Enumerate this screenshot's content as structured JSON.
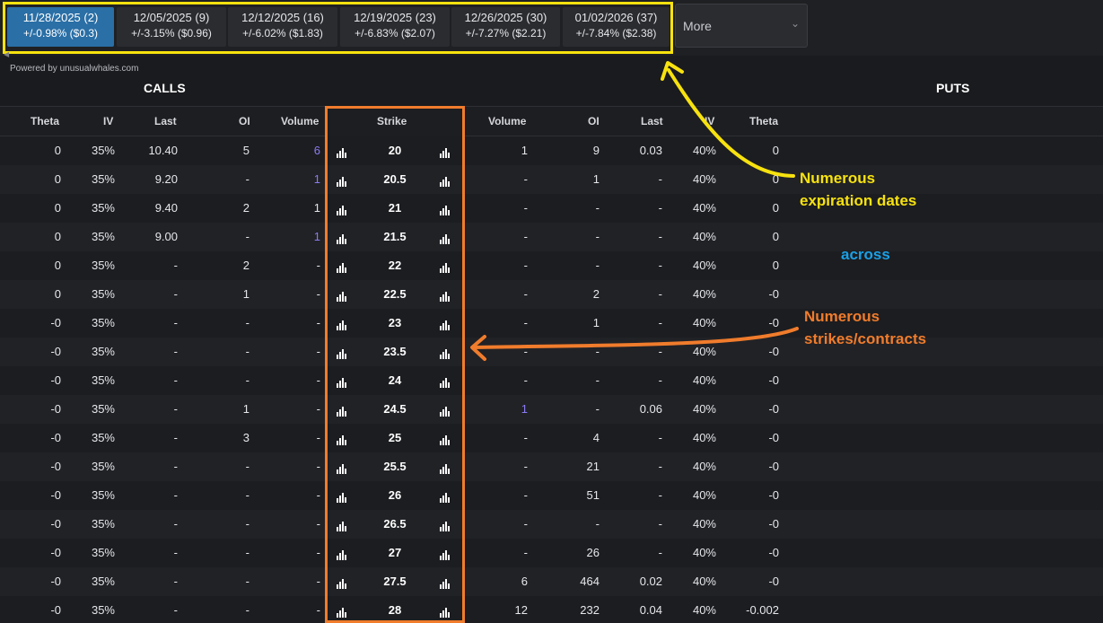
{
  "expirations": [
    {
      "date": "11/28/2025 (2)",
      "move": "+/-0.98% ($0.3)",
      "active": true
    },
    {
      "date": "12/05/2025 (9)",
      "move": "+/-3.15% ($0.96)",
      "active": false
    },
    {
      "date": "12/12/2025 (16)",
      "move": "+/-6.02% ($1.83)",
      "active": false
    },
    {
      "date": "12/19/2025 (23)",
      "move": "+/-6.83% ($2.07)",
      "active": false
    },
    {
      "date": "12/26/2025 (30)",
      "move": "+/-7.27% ($2.21)",
      "active": false
    },
    {
      "date": "01/02/2026 (37)",
      "move": "+/-7.84% ($2.38)",
      "active": false
    }
  ],
  "more_label": "More",
  "more_chevron": "⌄",
  "powered_by": "Powered by unusualwhales.com",
  "calls_title": "CALLS",
  "puts_title": "PUTS",
  "headers": {
    "calls": [
      "Theta",
      "IV",
      "Last",
      "OI",
      "Volume"
    ],
    "strike": "Strike",
    "puts": [
      "Volume",
      "OI",
      "Last",
      "IV",
      "Theta"
    ]
  },
  "rows": [
    {
      "c_theta": "0",
      "c_iv": "35%",
      "c_last": "10.40",
      "c_oi": "5",
      "c_vol": "6",
      "c_vol_hl": true,
      "strike": "20",
      "p_vol": "1",
      "p_vol_hl": false,
      "p_oi": "9",
      "p_last": "0.03",
      "p_iv": "40%",
      "p_theta": "0"
    },
    {
      "c_theta": "0",
      "c_iv": "35%",
      "c_last": "9.20",
      "c_oi": "-",
      "c_vol": "1",
      "c_vol_hl": true,
      "strike": "20.5",
      "p_vol": "-",
      "p_vol_hl": false,
      "p_oi": "1",
      "p_last": "-",
      "p_iv": "40%",
      "p_theta": "0"
    },
    {
      "c_theta": "0",
      "c_iv": "35%",
      "c_last": "9.40",
      "c_oi": "2",
      "c_vol": "1",
      "c_vol_hl": false,
      "strike": "21",
      "p_vol": "-",
      "p_vol_hl": false,
      "p_oi": "-",
      "p_last": "-",
      "p_iv": "40%",
      "p_theta": "0"
    },
    {
      "c_theta": "0",
      "c_iv": "35%",
      "c_last": "9.00",
      "c_oi": "-",
      "c_vol": "1",
      "c_vol_hl": true,
      "strike": "21.5",
      "p_vol": "-",
      "p_vol_hl": false,
      "p_oi": "-",
      "p_last": "-",
      "p_iv": "40%",
      "p_theta": "0"
    },
    {
      "c_theta": "0",
      "c_iv": "35%",
      "c_last": "-",
      "c_oi": "2",
      "c_vol": "-",
      "c_vol_hl": false,
      "strike": "22",
      "p_vol": "-",
      "p_vol_hl": false,
      "p_oi": "-",
      "p_last": "-",
      "p_iv": "40%",
      "p_theta": "0"
    },
    {
      "c_theta": "0",
      "c_iv": "35%",
      "c_last": "-",
      "c_oi": "1",
      "c_vol": "-",
      "c_vol_hl": false,
      "strike": "22.5",
      "p_vol": "-",
      "p_vol_hl": false,
      "p_oi": "2",
      "p_last": "-",
      "p_iv": "40%",
      "p_theta": "-0"
    },
    {
      "c_theta": "-0",
      "c_iv": "35%",
      "c_last": "-",
      "c_oi": "-",
      "c_vol": "-",
      "c_vol_hl": false,
      "strike": "23",
      "p_vol": "-",
      "p_vol_hl": false,
      "p_oi": "1",
      "p_last": "-",
      "p_iv": "40%",
      "p_theta": "-0"
    },
    {
      "c_theta": "-0",
      "c_iv": "35%",
      "c_last": "-",
      "c_oi": "-",
      "c_vol": "-",
      "c_vol_hl": false,
      "strike": "23.5",
      "p_vol": "-",
      "p_vol_hl": false,
      "p_oi": "-",
      "p_last": "-",
      "p_iv": "40%",
      "p_theta": "-0"
    },
    {
      "c_theta": "-0",
      "c_iv": "35%",
      "c_last": "-",
      "c_oi": "-",
      "c_vol": "-",
      "c_vol_hl": false,
      "strike": "24",
      "p_vol": "-",
      "p_vol_hl": false,
      "p_oi": "-",
      "p_last": "-",
      "p_iv": "40%",
      "p_theta": "-0"
    },
    {
      "c_theta": "-0",
      "c_iv": "35%",
      "c_last": "-",
      "c_oi": "1",
      "c_vol": "-",
      "c_vol_hl": false,
      "strike": "24.5",
      "p_vol": "1",
      "p_vol_hl": true,
      "p_oi": "-",
      "p_last": "0.06",
      "p_iv": "40%",
      "p_theta": "-0"
    },
    {
      "c_theta": "-0",
      "c_iv": "35%",
      "c_last": "-",
      "c_oi": "3",
      "c_vol": "-",
      "c_vol_hl": false,
      "strike": "25",
      "p_vol": "-",
      "p_vol_hl": false,
      "p_oi": "4",
      "p_last": "-",
      "p_iv": "40%",
      "p_theta": "-0"
    },
    {
      "c_theta": "-0",
      "c_iv": "35%",
      "c_last": "-",
      "c_oi": "-",
      "c_vol": "-",
      "c_vol_hl": false,
      "strike": "25.5",
      "p_vol": "-",
      "p_vol_hl": false,
      "p_oi": "21",
      "p_last": "-",
      "p_iv": "40%",
      "p_theta": "-0"
    },
    {
      "c_theta": "-0",
      "c_iv": "35%",
      "c_last": "-",
      "c_oi": "-",
      "c_vol": "-",
      "c_vol_hl": false,
      "strike": "26",
      "p_vol": "-",
      "p_vol_hl": false,
      "p_oi": "51",
      "p_last": "-",
      "p_iv": "40%",
      "p_theta": "-0"
    },
    {
      "c_theta": "-0",
      "c_iv": "35%",
      "c_last": "-",
      "c_oi": "-",
      "c_vol": "-",
      "c_vol_hl": false,
      "strike": "26.5",
      "p_vol": "-",
      "p_vol_hl": false,
      "p_oi": "-",
      "p_last": "-",
      "p_iv": "40%",
      "p_theta": "-0"
    },
    {
      "c_theta": "-0",
      "c_iv": "35%",
      "c_last": "-",
      "c_oi": "-",
      "c_vol": "-",
      "c_vol_hl": false,
      "strike": "27",
      "p_vol": "-",
      "p_vol_hl": false,
      "p_oi": "26",
      "p_last": "-",
      "p_iv": "40%",
      "p_theta": "-0"
    },
    {
      "c_theta": "-0",
      "c_iv": "35%",
      "c_last": "-",
      "c_oi": "-",
      "c_vol": "-",
      "c_vol_hl": false,
      "strike": "27.5",
      "p_vol": "6",
      "p_vol_hl": false,
      "p_oi": "464",
      "p_last": "0.02",
      "p_iv": "40%",
      "p_theta": "-0"
    },
    {
      "c_theta": "-0",
      "c_iv": "35%",
      "c_last": "-",
      "c_oi": "-",
      "c_vol": "-",
      "c_vol_hl": false,
      "strike": "28",
      "p_vol": "12",
      "p_vol_hl": false,
      "p_oi": "232",
      "p_last": "0.04",
      "p_iv": "40%",
      "p_theta": "-0.002"
    }
  ],
  "annotations": {
    "expirations_line1": "Numerous",
    "expirations_line2": "expiration dates",
    "across": "across",
    "strikes_line1": "Numerous",
    "strikes_line2": "strikes/contracts"
  },
  "colors": {
    "active_tab": "#2a6fa6",
    "strike_column": "#6b8193",
    "volume_highlight": "#8a7cf2",
    "annotation_yellow": "#f7e20f",
    "annotation_orange": "#f07c2c",
    "annotation_blue": "#1aa0e6"
  }
}
